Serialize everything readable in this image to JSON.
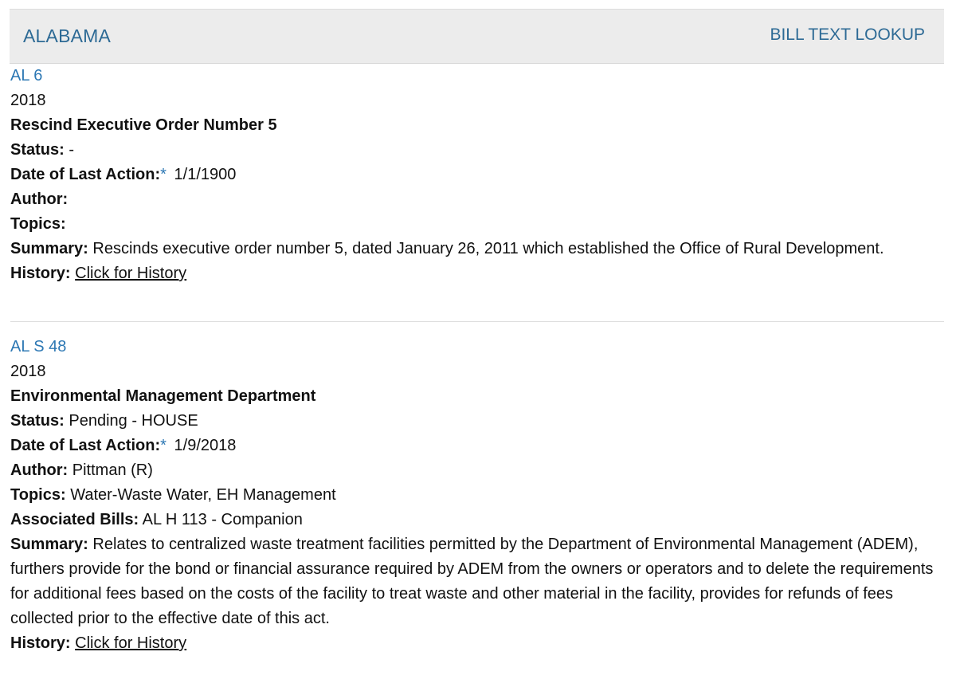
{
  "header": {
    "state": "ALABAMA",
    "lookup_label": "BILL TEXT LOOKUP"
  },
  "labels": {
    "status": "Status:",
    "date_last_action": "Date of Last Action:",
    "asterisk": "*",
    "author": "Author:",
    "topics": "Topics:",
    "associated_bills": "Associated Bills:",
    "summary": "Summary:",
    "history": "History:"
  },
  "bills": [
    {
      "id": "AL 6",
      "year": "2018",
      "title": "Rescind Executive Order Number 5",
      "status": "-",
      "date_last_action": "1/1/1900",
      "author": "",
      "topics": "",
      "summary": "Rescinds executive order number 5, dated January 26, 2011 which established the Office of Rural Development.",
      "history_link": "Click for History"
    },
    {
      "id": "AL S 48",
      "year": "2018",
      "title": "Environmental Management Department",
      "status": "Pending - HOUSE",
      "date_last_action": "1/9/2018",
      "author": "Pittman (R)",
      "topics": "Water-Waste Water, EH Management",
      "associated_bills": "AL H 113 - Companion",
      "summary": "Relates to centralized waste treatment facilities permitted by the Department of Environmental Management (ADEM), furthers provide for the bond or financial assurance required by ADEM from the owners or operators and to delete the requirements for additional fees based on the costs of the facility to treat waste and other material in the facility, provides for refunds of fees collected prior to the effective date of this act.",
      "history_link": "Click for History"
    }
  ]
}
